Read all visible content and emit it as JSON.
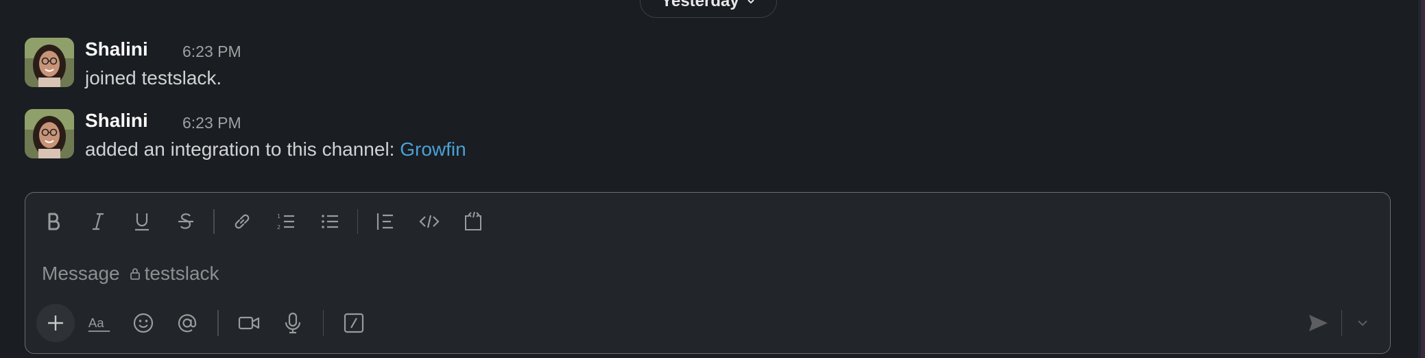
{
  "date_divider": {
    "label": "Yesterday"
  },
  "messages": [
    {
      "sender": "Shalini",
      "time": "6:23 PM",
      "text": "joined testslack.",
      "link": ""
    },
    {
      "sender": "Shalini",
      "time": "6:23 PM",
      "text": "added an integration to this channel: ",
      "link": "Growfin"
    }
  ],
  "composer": {
    "placeholder_prefix": "Message",
    "channel": "testslack",
    "format_tools": [
      "bold-icon",
      "italic-icon",
      "underline-icon",
      "strikethrough-icon",
      "link-icon",
      "ordered-list-icon",
      "bulleted-list-icon",
      "blockquote-icon",
      "code-icon",
      "code-block-icon"
    ],
    "actions": [
      "plus-icon",
      "text-format-icon",
      "emoji-icon",
      "mention-icon",
      "video-icon",
      "microphone-icon",
      "slash-command-icon"
    ]
  },
  "colors": {
    "background": "#1a1d21",
    "link": "#4aa1d8",
    "composer_bg": "#222529"
  }
}
